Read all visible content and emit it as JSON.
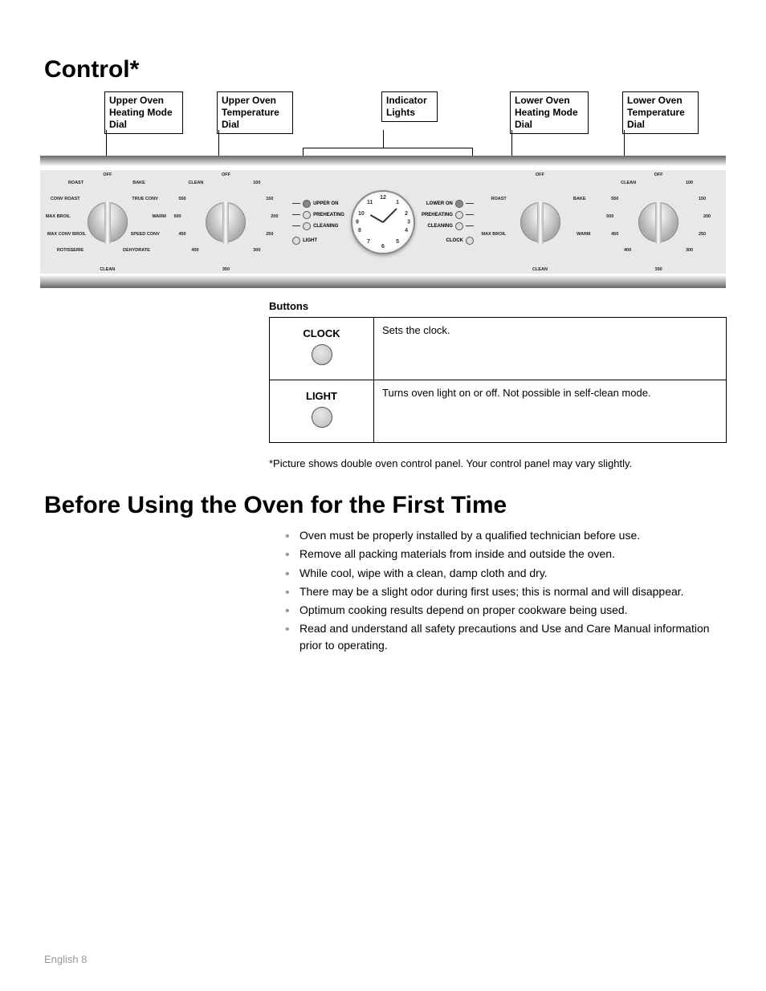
{
  "headings": {
    "control": "Control*",
    "before": "Before Using the Oven for the First Time"
  },
  "callouts": {
    "upper_mode": "Upper Oven\nHeating Mode\nDial",
    "upper_temp": "Upper Oven\nTemperature\nDial",
    "indicator": "Indicator\nLights",
    "lower_mode": "Lower Oven\nHeating Mode\nDial",
    "lower_temp": "Lower Oven\nTemperature\nDial"
  },
  "dials": {
    "upper_mode_labels": [
      "OFF",
      "BAKE",
      "TRUE CONV",
      "WARM",
      "SPEED CONV",
      "DEHYDRATE",
      "CLEAN",
      "ROTISSERIE",
      "MAX CONV BROIL",
      "MAX BROIL",
      "CONV ROAST",
      "ROAST"
    ],
    "upper_temp_labels": [
      "OFF",
      "100",
      "150",
      "200",
      "250",
      "300",
      "350",
      "400",
      "450",
      "500",
      "550",
      "CLEAN"
    ],
    "lower_mode_labels": [
      "OFF",
      "BAKE",
      "WARM",
      "CLEAN",
      "MAX BROIL",
      "ROAST"
    ],
    "lower_temp_labels": [
      "OFF",
      "100",
      "150",
      "200",
      "250",
      "300",
      "350",
      "400",
      "450",
      "500",
      "550",
      "CLEAN"
    ]
  },
  "indicators": {
    "left": [
      "UPPER ON",
      "PREHEATING",
      "CLEANING",
      "LIGHT"
    ],
    "right": [
      "LOWER ON",
      "PREHEATING",
      "CLEANING",
      "CLOCK"
    ]
  },
  "clock_numbers": [
    "12",
    "1",
    "2",
    "3",
    "4",
    "5",
    "6",
    "7",
    "8",
    "9",
    "10",
    "11"
  ],
  "buttons_title": "Buttons",
  "buttons": [
    {
      "name": "CLOCK",
      "desc": "Sets the clock."
    },
    {
      "name": "LIGHT",
      "desc": "Turns oven light on or off. Not possible in self-clean mode."
    }
  ],
  "footnote": "*Picture shows double oven control panel. Your control panel may vary slightly.",
  "before_list": [
    "Oven must be properly installed by a qualified technician before use.",
    "Remove all packing materials from inside and outside the oven.",
    "While cool, wipe with a clean, damp cloth and dry.",
    "There may be a slight odor during first uses; this is normal and will disappear.",
    "Optimum cooking results depend on proper cookware being used.",
    "Read and understand all safety precautions and Use and Care Manual information prior to operating."
  ],
  "footer": "English 8"
}
